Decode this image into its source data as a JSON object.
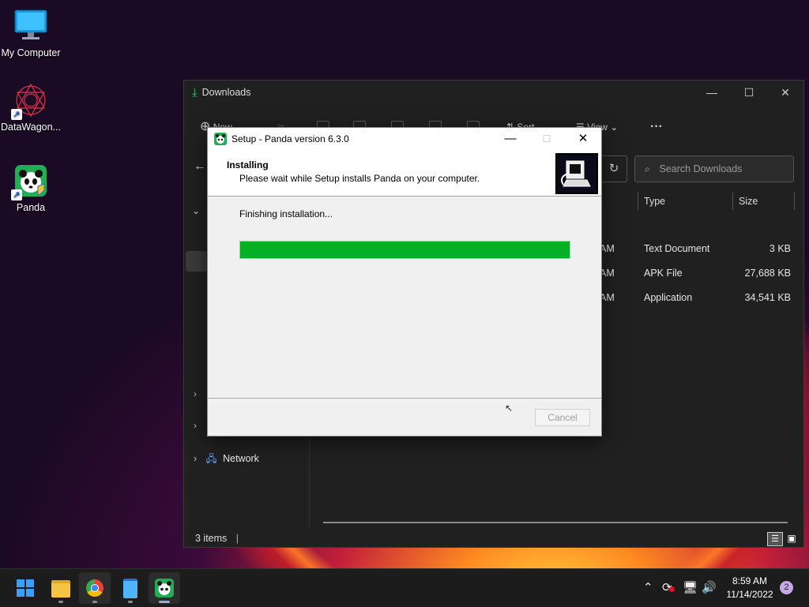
{
  "desktop": {
    "icons": [
      {
        "label": "My Computer"
      },
      {
        "label": "DataWagon..."
      },
      {
        "label": "Panda"
      }
    ]
  },
  "explorer": {
    "title": "Downloads",
    "toolbar": {
      "new": "New",
      "sort": "Sort",
      "view": "View",
      "more": "···"
    },
    "search_placeholder": "Search Downloads",
    "columns": {
      "type": "Type",
      "size": "Size"
    },
    "rows": [
      {
        "time_tail": "AM",
        "type": "Text Document",
        "size": "3 KB"
      },
      {
        "time_tail": "AM",
        "type": "APK File",
        "size": "27,688 KB"
      },
      {
        "time_tail": "AM",
        "type": "Application",
        "size": "34,541 KB"
      }
    ],
    "nav": {
      "network": "Network"
    },
    "status": "3 items"
  },
  "setup": {
    "title": "Setup - Panda version 6.3.0",
    "heading": "Installing",
    "subheading": "Please wait while Setup installs Panda on your computer.",
    "status_text": "Finishing installation...",
    "progress_fraction": 1.0,
    "cancel_label": "Cancel",
    "colors": {
      "progress": "#06b025"
    }
  },
  "taskbar": {
    "time": "8:59 AM",
    "date": "11/14/2022",
    "notification_count": "2"
  }
}
